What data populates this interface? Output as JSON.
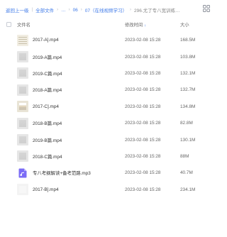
{
  "breadcrumb": {
    "items": [
      "返回上一级",
      "全部文件",
      "…",
      "06",
      "07（在线视频学习）"
    ],
    "current": "296.尤了专八宽训练…"
  },
  "table": {
    "headers": {
      "name": "文件名",
      "modified": "修改时间",
      "size": "大小"
    },
    "sort_indicator": "↓",
    "rows": [
      {
        "name": "2017-A].mp4",
        "modified": "2023-02-08 15:28",
        "size": "168.5M",
        "thumb": "t-doc"
      },
      {
        "name": "2019-A篇.mp4",
        "modified": "2023-02-08 15:28",
        "size": "103.8M",
        "thumb": "t-gray"
      },
      {
        "name": "2019-C篇.mp4",
        "modified": "2023-02-08 15:28",
        "size": "132.1M",
        "thumb": "t-gray"
      },
      {
        "name": "2018-A篇.mp4",
        "modified": "2023-02-08 15:28",
        "size": "132.7M",
        "thumb": "t-gray"
      },
      {
        "name": "2017-C].mp4",
        "modified": "2023-02-08 15:28",
        "size": "134.8M",
        "thumb": "t-mixed"
      },
      {
        "name": "2018-B篇.mp4",
        "modified": "2023-02-08 15:28",
        "size": "82.8M",
        "thumb": "t-gray"
      },
      {
        "name": "2019-B篇.mp4",
        "modified": "2023-02-08 15:28",
        "size": "130.1M",
        "thumb": "t-gray"
      },
      {
        "name": "2018-C篇.mp4",
        "modified": "2023-02-08 15:28",
        "size": "88M",
        "thumb": "t-gray"
      },
      {
        "name": "专八考纲解读+备考范路.mp3",
        "modified": "2023-02-08 15:28",
        "size": "40.7M",
        "thumb": "audio"
      },
      {
        "name": "2017-B].mp4",
        "modified": "2023-02-08 15:28",
        "size": "234.1M",
        "thumb": "t-light"
      }
    ]
  },
  "icons": {
    "layout": "grid-view-icon",
    "audio": "music-file-icon"
  },
  "colors": {
    "accent": "#3f7ae8",
    "audio": "#7b6cf6"
  }
}
